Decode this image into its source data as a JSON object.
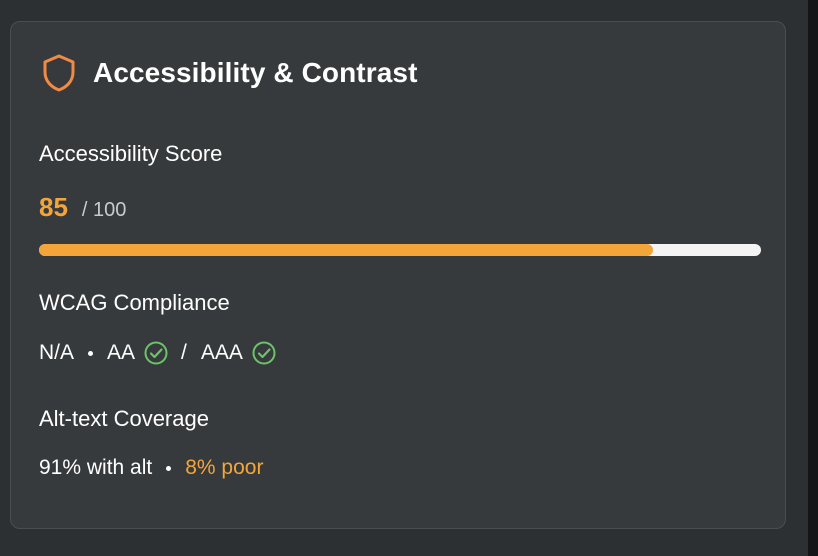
{
  "card": {
    "title": "Accessibility & Contrast",
    "icon": "shield-icon",
    "accent_color": "#f4a53a",
    "success_color": "#6cc36a"
  },
  "score": {
    "label": "Accessibility Score",
    "value": "85",
    "max": "/ 100",
    "progress_fraction": 0.85
  },
  "wcag": {
    "label": "WCAG Compliance",
    "level_a": "N/A",
    "level_aa": "AA",
    "separator": "/",
    "level_aaa": "AAA",
    "aa_status_icon": "check-circle-icon",
    "aaa_status_icon": "check-circle-icon"
  },
  "alt_text": {
    "label": "Alt-text Coverage",
    "with_alt": "91% with alt",
    "poor": "8% poor"
  }
}
